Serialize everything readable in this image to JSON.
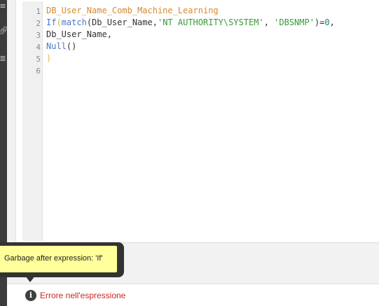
{
  "sidebar": {
    "icons": [
      "menu-icon",
      "link-icon",
      "database-icon"
    ]
  },
  "editor": {
    "line_numbers": [
      "1",
      "2",
      "3",
      "4",
      "5",
      "6"
    ],
    "line1": {
      "field": "DB_User_Name_Comb_Machine_Learning"
    },
    "line2": {
      "if_kw": "If",
      "open1": "(",
      "match_kw": "match",
      "args_plain": "(Db_User_Name,",
      "str1": "'NT AUTHORITY\\SYSTEM'",
      "sep": ", ",
      "str2": "'DBSNMP'",
      "close_eq": ")=",
      "num": "0",
      "comma": ","
    },
    "line3": {
      "text": "Db_User_Name,"
    },
    "line4": {
      "null_kw": "Null",
      "parens": "()"
    },
    "line5": {
      "close": ")"
    }
  },
  "tooltip": {
    "text": "Garbage after expression: 'If'"
  },
  "status": {
    "icon": "info-icon",
    "message": "Errore nell'espressione"
  },
  "colors": {
    "field": "#d88a2e",
    "function": "#4a78c9",
    "string": "#3a9a3a",
    "error": "#c62828",
    "tooltip_bg": "#ffff9c"
  }
}
